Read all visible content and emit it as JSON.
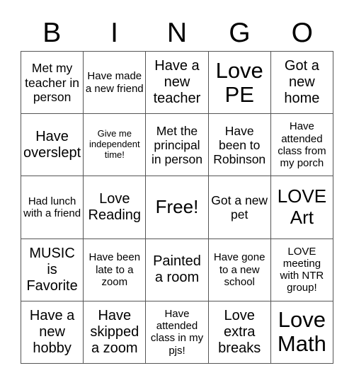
{
  "header": {
    "letters": [
      "B",
      "I",
      "N",
      "G",
      "O"
    ]
  },
  "board": {
    "cells": [
      [
        "Met my teacher in person",
        "Have made a new friend",
        "Have a new teacher",
        "Love PE",
        "Got a new home"
      ],
      [
        "Have overslept",
        "Give me independent time!",
        "Met the principal in person",
        "Have been to Robinson",
        "Have attended class from my porch"
      ],
      [
        "Had lunch with a friend",
        "Love Reading",
        "Free!",
        "Got a new pet",
        "LOVE Art"
      ],
      [
        "MUSIC is Favorite",
        "Have been late to a zoom",
        "Painted a room",
        "Have gone to a new school",
        "LOVE meeting with NTR group!"
      ],
      [
        "Have a new hobby",
        "Have skipped a zoom",
        "Have attended class in my pjs!",
        "Love extra breaks",
        "Love Math"
      ]
    ],
    "free_space": {
      "row": 2,
      "col": 2
    }
  }
}
